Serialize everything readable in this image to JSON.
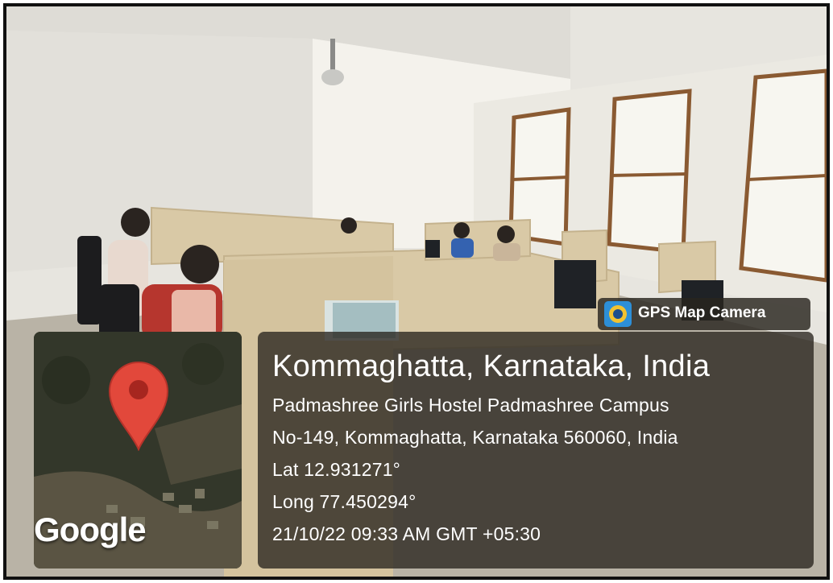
{
  "badge": {
    "label": "GPS Map Camera",
    "icon": "camera-lens-icon"
  },
  "map": {
    "brand": "Google",
    "pin_icon": "location-pin-icon",
    "pin_color": "#e2483b"
  },
  "location": {
    "title": "Kommaghatta, Karnataka, India",
    "address_line1": "Padmashree Girls Hostel Padmashree Campus",
    "address_line2": "No-149, Kommaghatta, Karnataka 560060, India",
    "lat": "Lat 12.931271°",
    "long": "Long 77.450294°",
    "timestamp": "21/10/22 09:33 AM GMT +05:30"
  }
}
